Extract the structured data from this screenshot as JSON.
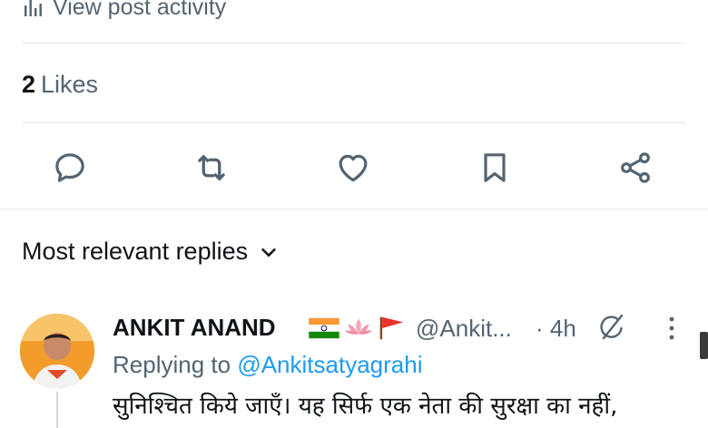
{
  "post": {
    "activity_label": "View post activity",
    "likes_count": "2",
    "likes_label": "Likes"
  },
  "actions": [
    {
      "name": "reply-button",
      "icon": "reply-icon"
    },
    {
      "name": "repost-button",
      "icon": "repost-icon"
    },
    {
      "name": "like-button",
      "icon": "heart-icon"
    },
    {
      "name": "bookmark-button",
      "icon": "bookmark-icon"
    },
    {
      "name": "share-button",
      "icon": "share-icon"
    }
  ],
  "replies": {
    "sort_label": "Most relevant replies",
    "items": [
      {
        "author_name": "ANKIT ANAND",
        "handle": "@Ankit...",
        "time": "· 4h",
        "replying_prefix": "Replying to ",
        "replying_to": "@Ankitsatyagrahi",
        "text": "सुनिश्चित किये जाएँ। यह सिर्फ एक नेता की सुरक्षा का नहीं,"
      }
    ]
  },
  "colors": {
    "text_primary": "#0f1419",
    "text_secondary": "#536471",
    "link": "#1d9bf0",
    "divider": "#e6e9ec",
    "avatar_bg": "#f29c2b"
  }
}
